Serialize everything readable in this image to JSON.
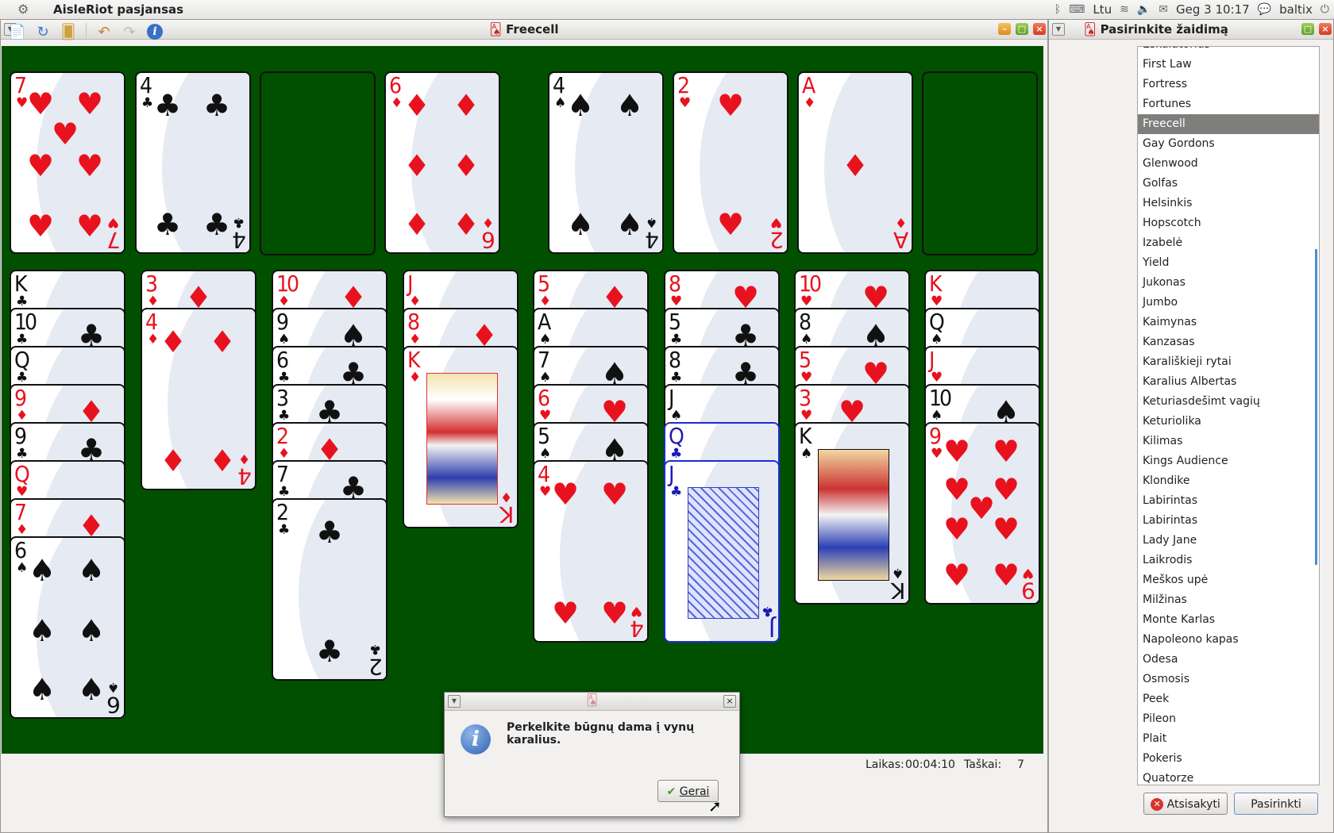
{
  "panel": {
    "app_name": "AisleRiot pasjansas",
    "keyboard": "Ltu",
    "datetime": "Geg 3 10:17",
    "user": "baltix"
  },
  "game_window": {
    "title": "Freecell",
    "toolbar": [
      "new-game-icon",
      "restart-icon",
      "hint-icon",
      "undo-icon",
      "redo-icon",
      "info-icon"
    ]
  },
  "status": {
    "time_label": "Laikas:",
    "time_value": "00:04:10",
    "score_label": "Taškai:",
    "score_value": "7"
  },
  "dialog": {
    "message": "Perkelkite būgnų dama į vynų karalius.",
    "ok_label": "Gerai"
  },
  "side_panel": {
    "title": "Pasirinkite žaidimą",
    "selected": "Freecell",
    "games": [
      "Eskalatorius",
      "First Law",
      "Fortress",
      "Fortunes",
      "Freecell",
      "Gay Gordons",
      "Glenwood",
      "Golfas",
      "Helsinkis",
      "Hopscotch",
      "Izabelė",
      "Yield",
      "Jukonas",
      "Jumbo",
      "Kaimynas",
      "Kanzasas",
      "Karališkieji rytai",
      "Karalius Albertas",
      "Keturiasdešimt vagių",
      "Keturiolika",
      "Kilimas",
      "Kings Audience",
      "Klondike",
      "Labirintas",
      "Labirintas",
      "Lady Jane",
      "Laikrodis",
      "Meškos upė",
      "Milžinas",
      "Monte Karlas",
      "Napoleono kapas",
      "Odesa",
      "Osmosis",
      "Peek",
      "Pileon",
      "Plait",
      "Pokeris",
      "Quatorze"
    ],
    "cancel_label": "Atsisakyti",
    "select_label": "Pasirinkti"
  },
  "colors": {
    "felt": "#005000",
    "selection_blue": "#1c2bd6",
    "red_suit": "#e8121e"
  },
  "cards": {
    "top_left": [
      "7♥",
      "4♣",
      "",
      "6♦"
    ],
    "foundations": [
      "4♠",
      "2♥",
      "A♦",
      ""
    ],
    "columns": [
      [
        "K♣",
        "10♣",
        "Q♣",
        "9♦",
        "9♣",
        "Q♥",
        "7♦",
        "6♠"
      ],
      [
        "3♦",
        "4♦"
      ],
      [
        "10♦",
        "9♠",
        "6♣",
        "3♣",
        "2♦",
        "7♣",
        "2♣"
      ],
      [
        "J♦",
        "8♦",
        "K♦"
      ],
      [
        "5♦",
        "A♠",
        "7♠",
        "6♥",
        "5♠",
        "4♥"
      ],
      [
        "8♥",
        "5♣",
        "8♣",
        "J♠",
        "Q♣",
        "J♣"
      ],
      [
        "10♥",
        "8♠",
        "5♥",
        "3♥",
        "K♠"
      ],
      [
        "K♥",
        "Q♠",
        "J♥",
        "10♠",
        "9♥"
      ]
    ]
  }
}
